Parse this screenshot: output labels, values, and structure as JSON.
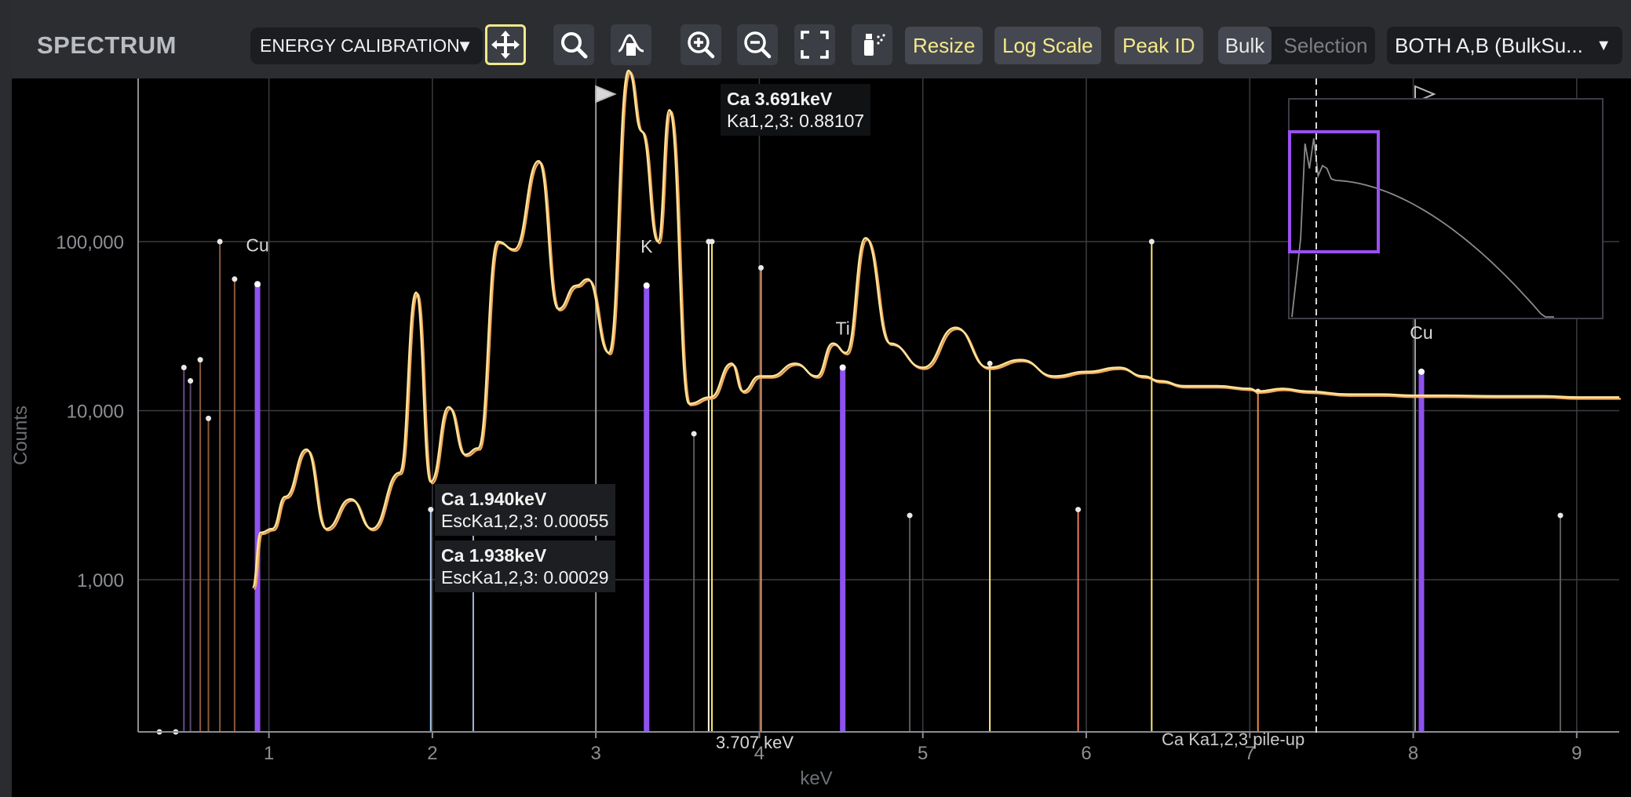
{
  "app": {
    "title": "SPECTRUM"
  },
  "toolbar": {
    "calibration_label": "ENERGY CALIBRATION",
    "tools": [
      {
        "name": "pan-tool",
        "icon": "move-arrows-icon",
        "active": true
      },
      {
        "name": "magnify-tool",
        "icon": "magnifier-icon",
        "active": false
      },
      {
        "name": "peak-fit-tool",
        "icon": "peak-fit-icon",
        "active": false
      },
      {
        "name": "zoom-in-tool",
        "icon": "zoom-in-icon",
        "active": false
      },
      {
        "name": "zoom-out-tool",
        "icon": "zoom-out-icon",
        "active": false
      },
      {
        "name": "fit-view-tool",
        "icon": "fullscreen-icon",
        "active": false
      },
      {
        "name": "spray-tool",
        "icon": "spray-icon",
        "active": false
      }
    ],
    "resize_label": "Resize",
    "logscale_label": "Log Scale",
    "peakid_label": "Peak ID",
    "bulk_label": "Bulk",
    "selection_label": "Selection",
    "source_label": "BOTH A,B (BulkSu..."
  },
  "chart_data": {
    "type": "line",
    "xlabel": "keV",
    "ylabel": "Counts",
    "yscale": "log",
    "xlim": [
      0.2,
      9.26
    ],
    "ylim": [
      130,
      1000000
    ],
    "x_ticks": [
      "1",
      "2",
      "3",
      "4",
      "5",
      "6",
      "7",
      "8",
      "9"
    ],
    "y_ticks": [
      "1,000",
      "10,000",
      "100,000"
    ],
    "grid": true,
    "series": [
      {
        "name": "A",
        "color": "#ffe49a",
        "x": [
          0.9,
          0.95,
          1.02,
          1.1,
          1.23,
          1.35,
          1.5,
          1.63,
          1.8,
          1.9,
          1.99,
          2.1,
          2.2,
          2.28,
          2.4,
          2.5,
          2.65,
          2.77,
          2.88,
          2.95,
          3.08,
          3.2,
          3.28,
          3.38,
          3.45,
          3.57,
          3.7,
          3.83,
          3.9,
          4.0,
          4.07,
          4.22,
          4.35,
          4.45,
          4.53,
          4.65,
          4.8,
          5.0,
          5.2,
          5.4,
          5.6,
          5.8,
          6.0,
          6.2,
          6.35,
          6.45,
          6.6,
          6.8,
          7.0,
          7.05,
          7.2,
          7.35,
          7.6,
          7.8,
          8.0,
          8.2,
          8.5,
          8.8,
          9.0,
          9.26
        ],
        "y": [
          900,
          1900,
          2000,
          3100,
          5900,
          2000,
          3000,
          2000,
          4300,
          50000,
          3800,
          10500,
          5500,
          6000,
          100000,
          90000,
          300000,
          40000,
          55000,
          60000,
          22000,
          2000000,
          450000,
          100000,
          600000,
          11000,
          12000,
          19000,
          13000,
          16000,
          16000,
          19000,
          16000,
          25000,
          22000,
          105000,
          25000,
          18000,
          31000,
          18000,
          20000,
          16000,
          17000,
          18000,
          16000,
          15000,
          14000,
          14000,
          13500,
          13000,
          13500,
          13000,
          12500,
          12500,
          12300,
          12300,
          12200,
          12200,
          12000,
          12000
        ]
      }
    ],
    "markers": [
      {
        "element": "Cu",
        "energy": 0.93,
        "height": 56000
      },
      {
        "element": "K",
        "energy": 3.31,
        "height": 55000
      },
      {
        "element": "Ti",
        "energy": 4.51,
        "height": 18000
      },
      {
        "element": "Cu",
        "energy": 8.05,
        "height": 17000
      }
    ],
    "tooltips": [
      {
        "title": "Ca 3.691keV",
        "detail": "Ka1,2,3: 0.88107"
      },
      {
        "title": "Ca 1.940keV",
        "detail": "EscKa1,2,3: 0.00055"
      },
      {
        "title": "Ca 1.938keV",
        "detail": "EscKa1,2,3: 0.00029"
      }
    ],
    "annotations": [
      "3.707 keV",
      "Ca Ka1,2,3 pile-up"
    ]
  }
}
